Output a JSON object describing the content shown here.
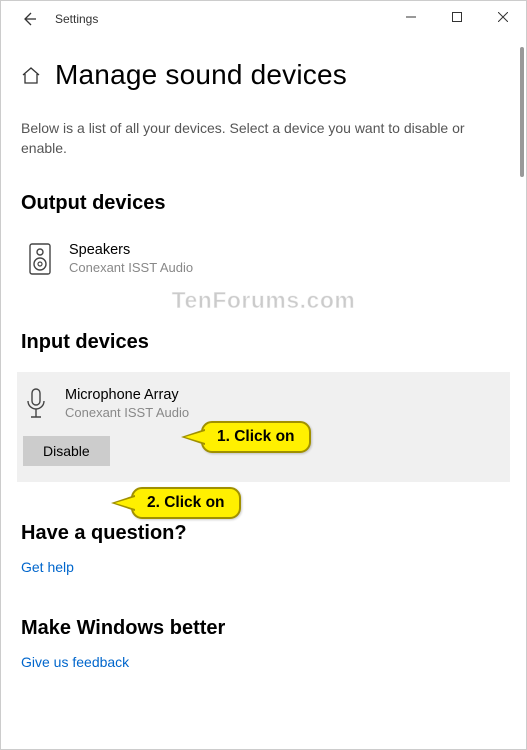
{
  "titlebar": {
    "app_title": "Settings"
  },
  "page": {
    "title": "Manage sound devices",
    "description": "Below is a list of all your devices. Select a device you want to disable or enable."
  },
  "output_section": {
    "title": "Output devices",
    "device": {
      "name": "Speakers",
      "sub": "Conexant ISST Audio"
    }
  },
  "input_section": {
    "title": "Input devices",
    "device": {
      "name": "Microphone Array",
      "sub": "Conexant ISST Audio"
    },
    "disable_label": "Disable"
  },
  "footer": {
    "question_title": "Have a question?",
    "help_link": "Get help",
    "feedback_title": "Make Windows better",
    "feedback_link": "Give us feedback"
  },
  "annotations": {
    "callout1": "1. Click on",
    "callout2": "2. Click on",
    "watermark": "TenForums.com"
  }
}
